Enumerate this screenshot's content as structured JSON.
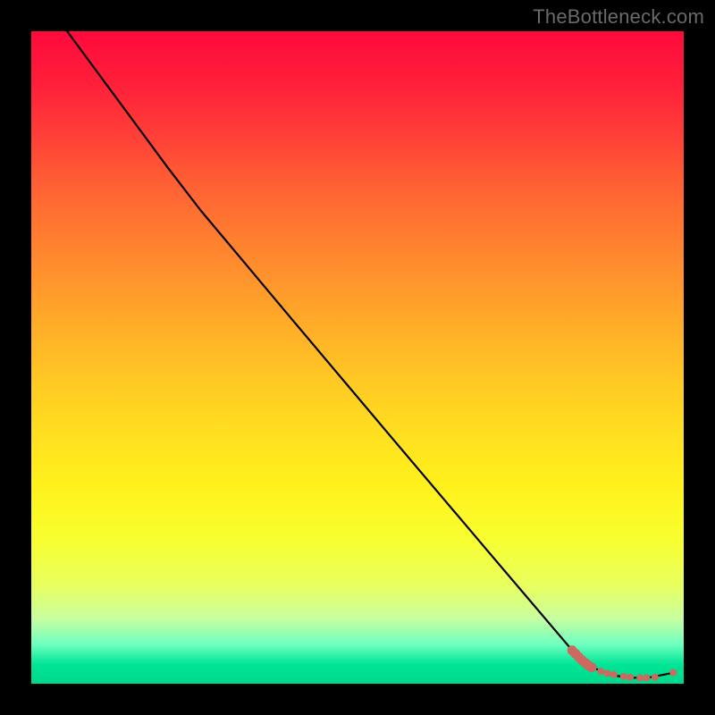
{
  "watermark": "TheBottleneck.com",
  "chart_data": {
    "type": "line",
    "title": "",
    "xlabel": "",
    "ylabel": "",
    "xlim": [
      0,
      100
    ],
    "ylim": [
      0,
      100
    ],
    "background_gradient": {
      "top": "#ff0a3c",
      "mid": "#ffe020",
      "bottom": "#00d88c"
    },
    "curve": [
      {
        "x": 5.5,
        "y": 100.0
      },
      {
        "x": 21.0,
        "y": 79.0
      },
      {
        "x": 26.0,
        "y": 72.5
      },
      {
        "x": 40.0,
        "y": 55.8
      },
      {
        "x": 55.0,
        "y": 38.0
      },
      {
        "x": 70.0,
        "y": 20.3
      },
      {
        "x": 82.5,
        "y": 5.6
      },
      {
        "x": 86.0,
        "y": 2.5
      },
      {
        "x": 89.0,
        "y": 1.3
      },
      {
        "x": 92.0,
        "y": 0.9
      },
      {
        "x": 95.0,
        "y": 1.0
      },
      {
        "x": 98.0,
        "y": 1.6
      }
    ],
    "markers": {
      "color": "#cc6a60",
      "radius_small": 4.0,
      "radius_large": 5.5,
      "points": [
        {
          "x": 82.9,
          "y": 5.1,
          "r": "large"
        },
        {
          "x": 83.4,
          "y": 4.6,
          "r": "large"
        },
        {
          "x": 83.9,
          "y": 4.1,
          "r": "large"
        },
        {
          "x": 84.4,
          "y": 3.6,
          "r": "large"
        },
        {
          "x": 84.9,
          "y": 3.2,
          "r": "large"
        },
        {
          "x": 85.4,
          "y": 2.8,
          "r": "large"
        },
        {
          "x": 85.9,
          "y": 2.5,
          "r": "large"
        },
        {
          "x": 87.3,
          "y": 1.9,
          "r": "small"
        },
        {
          "x": 88.3,
          "y": 1.6,
          "r": "small"
        },
        {
          "x": 89.3,
          "y": 1.4,
          "r": "small"
        },
        {
          "x": 90.8,
          "y": 1.1,
          "r": "small"
        },
        {
          "x": 91.8,
          "y": 1.0,
          "r": "small"
        },
        {
          "x": 93.3,
          "y": 0.9,
          "r": "small"
        },
        {
          "x": 94.3,
          "y": 0.9,
          "r": "small"
        },
        {
          "x": 95.6,
          "y": 1.0,
          "r": "small"
        },
        {
          "x": 98.4,
          "y": 1.7,
          "r": "small"
        }
      ]
    }
  }
}
